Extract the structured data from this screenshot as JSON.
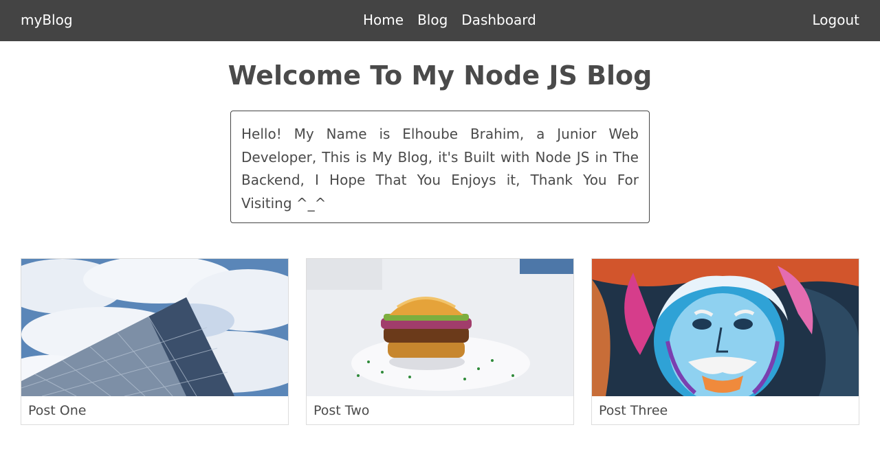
{
  "nav": {
    "brand": "myBlog",
    "links": [
      "Home",
      "Blog",
      "Dashboard"
    ],
    "logout": "Logout"
  },
  "header": {
    "title": "Welcome To My Node JS Blog"
  },
  "intro": {
    "text": "Hello! My Name is Elhoube Brahim, a Junior Web Developer, This is My Blog, it's Built with Node JS in The Backend, I Hope That You Enjoys it, Thank You For Visiting ^_^"
  },
  "posts": [
    {
      "title": "Post One",
      "image": "building-image"
    },
    {
      "title": "Post Two",
      "image": "burger-image"
    },
    {
      "title": "Post Three",
      "image": "einstein-graffiti-image"
    }
  ],
  "colors": {
    "navbar": "#444444",
    "text": "#4a4a4a",
    "card_border": "#dcdcdc"
  }
}
